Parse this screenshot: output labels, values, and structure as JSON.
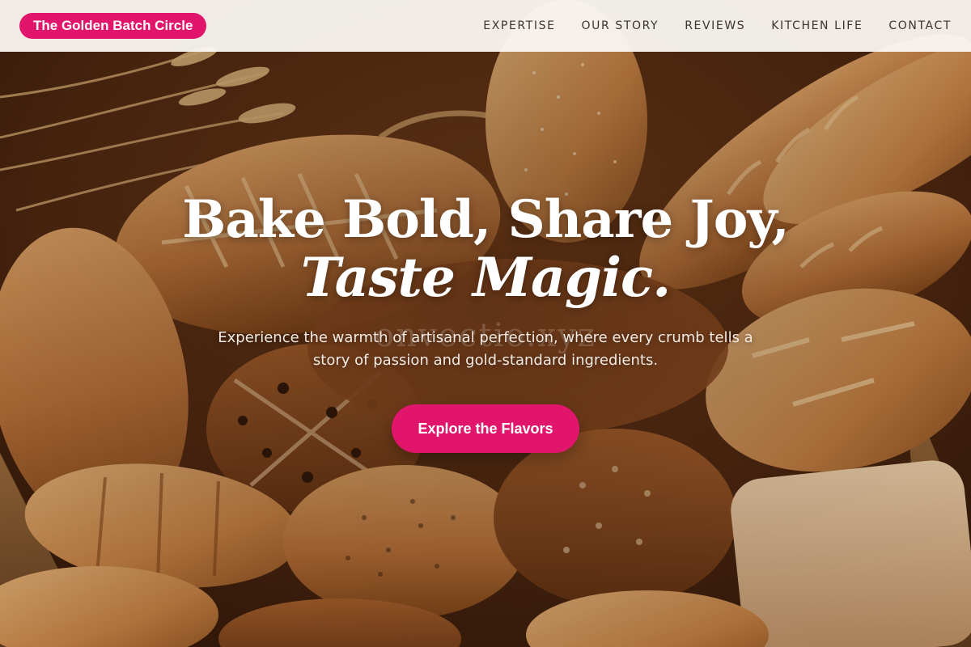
{
  "header": {
    "brand": "The Golden Batch Circle",
    "nav": [
      "EXPERTISE",
      "OUR STORY",
      "REVIEWS",
      "KITCHEN LIFE",
      "CONTACT"
    ]
  },
  "hero": {
    "headline_line1": "Bake Bold, Share Joy,",
    "headline_line2": "Taste Magic.",
    "subtitle": "Experience the warmth of artisanal perfection, where every crumb tells a story of passion and gold-standard ingredients.",
    "cta_label": "Explore the Flavors",
    "background": "bread-basket-image",
    "watermark": "onvectio.xyz"
  },
  "colors": {
    "accent": "#e0156b",
    "header_bg": "#faf7f3",
    "nav_text": "#3a3330",
    "headline": "#ffffff"
  }
}
